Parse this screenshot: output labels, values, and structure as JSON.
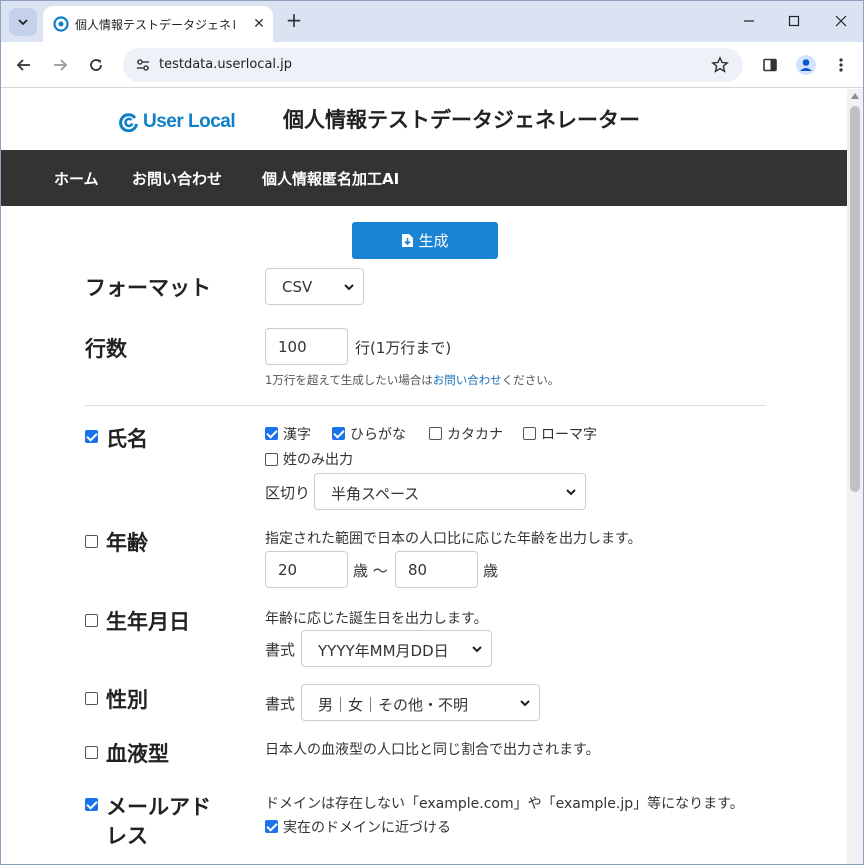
{
  "browser": {
    "tab_title": "個人情報テストデータジェネレーター",
    "url": "testdata.userlocal.jp",
    "icons": [
      "tab-search-icon",
      "tab-close-icon",
      "new-tab-icon",
      "minimize-icon",
      "maximize-icon",
      "close-window-icon",
      "back-icon",
      "forward-icon",
      "reload-icon",
      "site-info-icon",
      "star-icon",
      "side-panel-icon",
      "profile-icon",
      "menu-icon"
    ]
  },
  "site": {
    "logo_text": "User Local",
    "title": "個人情報テストデータジェネレーター",
    "nav": [
      "ホーム",
      "お問い合わせ",
      "個人情報匿名加工AI"
    ],
    "generate_label": "生成",
    "accent_color": "#1a83d3",
    "nav_bg": "#333333"
  },
  "form": {
    "format": {
      "label": "フォーマット",
      "value": "CSV"
    },
    "rows": {
      "label": "行数",
      "value": "100",
      "suffix": "行(1万行まで)",
      "note_pre": "1万行を超えて生成したい場合は",
      "note_link": "お問い合わせ",
      "note_post": "ください。"
    },
    "name": {
      "label": "氏名",
      "checked": true,
      "options": [
        {
          "label": "漢字",
          "checked": true
        },
        {
          "label": "ひらがな",
          "checked": true
        },
        {
          "label": "カタカナ",
          "checked": false
        },
        {
          "label": "ローマ字",
          "checked": false
        },
        {
          "label": "姓のみ出力",
          "checked": false
        }
      ],
      "separator_label": "区切り",
      "separator_value": "半角スペース"
    },
    "age": {
      "label": "年齢",
      "checked": false,
      "desc": "指定された範囲で日本の人口比に応じた年齢を出力します。",
      "min": "20",
      "min_unit": "歳 〜",
      "max": "80",
      "max_unit": "歳"
    },
    "birthday": {
      "label": "生年月日",
      "checked": false,
      "desc": "年齢に応じた誕生日を出力します。",
      "format_label": "書式",
      "format_value": "YYYY年MM月DD日"
    },
    "gender": {
      "label": "性別",
      "checked": false,
      "format_label": "書式",
      "format_value": "男｜女｜その他・不明"
    },
    "blood": {
      "label": "血液型",
      "checked": false,
      "desc": "日本人の血液型の人口比と同じ割合で出力されます。"
    },
    "email": {
      "label_line1": "メールアド",
      "label_line2": "レス",
      "checked": true,
      "desc": "ドメインは存在しない「example.com」や「example.jp」等になります。",
      "option": {
        "label": "実在のドメインに近づける",
        "checked": true
      }
    }
  }
}
